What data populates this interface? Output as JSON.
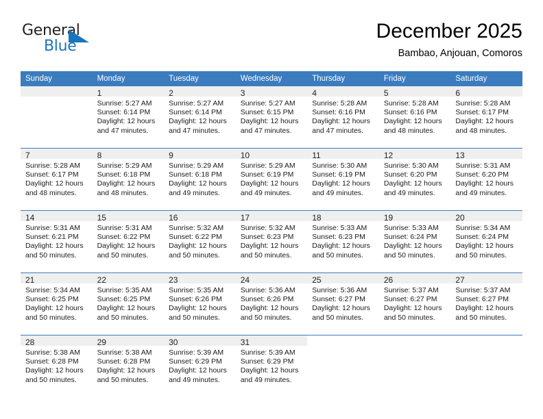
{
  "logo": {
    "text_top": "General",
    "text_bottom": "Blue",
    "brand_dark": "#231f20",
    "brand_blue": "#1b75bb"
  },
  "header": {
    "title": "December 2025",
    "subtitle": "Bambao, Anjouan, Comoros"
  },
  "calendar": {
    "header_bg": "#3b7cbe",
    "daynum_bg": "#efefef",
    "weekday_headers": [
      "Sunday",
      "Monday",
      "Tuesday",
      "Wednesday",
      "Thursday",
      "Friday",
      "Saturday"
    ],
    "weeks": [
      [
        {
          "day": "",
          "sunrise": "",
          "sunset": "",
          "daylight_line1": "",
          "daylight_line2": "",
          "state": "empty"
        },
        {
          "day": "1",
          "sunrise": "Sunrise: 5:27 AM",
          "sunset": "Sunset: 6:14 PM",
          "daylight_line1": "Daylight: 12 hours",
          "daylight_line2": "and 47 minutes.",
          "state": "filled"
        },
        {
          "day": "2",
          "sunrise": "Sunrise: 5:27 AM",
          "sunset": "Sunset: 6:14 PM",
          "daylight_line1": "Daylight: 12 hours",
          "daylight_line2": "and 47 minutes.",
          "state": "filled"
        },
        {
          "day": "3",
          "sunrise": "Sunrise: 5:27 AM",
          "sunset": "Sunset: 6:15 PM",
          "daylight_line1": "Daylight: 12 hours",
          "daylight_line2": "and 47 minutes.",
          "state": "filled"
        },
        {
          "day": "4",
          "sunrise": "Sunrise: 5:28 AM",
          "sunset": "Sunset: 6:16 PM",
          "daylight_line1": "Daylight: 12 hours",
          "daylight_line2": "and 47 minutes.",
          "state": "filled"
        },
        {
          "day": "5",
          "sunrise": "Sunrise: 5:28 AM",
          "sunset": "Sunset: 6:16 PM",
          "daylight_line1": "Daylight: 12 hours",
          "daylight_line2": "and 48 minutes.",
          "state": "filled"
        },
        {
          "day": "6",
          "sunrise": "Sunrise: 5:28 AM",
          "sunset": "Sunset: 6:17 PM",
          "daylight_line1": "Daylight: 12 hours",
          "daylight_line2": "and 48 minutes.",
          "state": "filled"
        }
      ],
      [
        {
          "day": "7",
          "sunrise": "Sunrise: 5:28 AM",
          "sunset": "Sunset: 6:17 PM",
          "daylight_line1": "Daylight: 12 hours",
          "daylight_line2": "and 48 minutes.",
          "state": "filled"
        },
        {
          "day": "8",
          "sunrise": "Sunrise: 5:29 AM",
          "sunset": "Sunset: 6:18 PM",
          "daylight_line1": "Daylight: 12 hours",
          "daylight_line2": "and 48 minutes.",
          "state": "filled"
        },
        {
          "day": "9",
          "sunrise": "Sunrise: 5:29 AM",
          "sunset": "Sunset: 6:18 PM",
          "daylight_line1": "Daylight: 12 hours",
          "daylight_line2": "and 49 minutes.",
          "state": "filled"
        },
        {
          "day": "10",
          "sunrise": "Sunrise: 5:29 AM",
          "sunset": "Sunset: 6:19 PM",
          "daylight_line1": "Daylight: 12 hours",
          "daylight_line2": "and 49 minutes.",
          "state": "filled"
        },
        {
          "day": "11",
          "sunrise": "Sunrise: 5:30 AM",
          "sunset": "Sunset: 6:19 PM",
          "daylight_line1": "Daylight: 12 hours",
          "daylight_line2": "and 49 minutes.",
          "state": "filled"
        },
        {
          "day": "12",
          "sunrise": "Sunrise: 5:30 AM",
          "sunset": "Sunset: 6:20 PM",
          "daylight_line1": "Daylight: 12 hours",
          "daylight_line2": "and 49 minutes.",
          "state": "filled"
        },
        {
          "day": "13",
          "sunrise": "Sunrise: 5:31 AM",
          "sunset": "Sunset: 6:20 PM",
          "daylight_line1": "Daylight: 12 hours",
          "daylight_line2": "and 49 minutes.",
          "state": "filled"
        }
      ],
      [
        {
          "day": "14",
          "sunrise": "Sunrise: 5:31 AM",
          "sunset": "Sunset: 6:21 PM",
          "daylight_line1": "Daylight: 12 hours",
          "daylight_line2": "and 50 minutes.",
          "state": "filled"
        },
        {
          "day": "15",
          "sunrise": "Sunrise: 5:31 AM",
          "sunset": "Sunset: 6:22 PM",
          "daylight_line1": "Daylight: 12 hours",
          "daylight_line2": "and 50 minutes.",
          "state": "filled"
        },
        {
          "day": "16",
          "sunrise": "Sunrise: 5:32 AM",
          "sunset": "Sunset: 6:22 PM",
          "daylight_line1": "Daylight: 12 hours",
          "daylight_line2": "and 50 minutes.",
          "state": "filled"
        },
        {
          "day": "17",
          "sunrise": "Sunrise: 5:32 AM",
          "sunset": "Sunset: 6:23 PM",
          "daylight_line1": "Daylight: 12 hours",
          "daylight_line2": "and 50 minutes.",
          "state": "filled"
        },
        {
          "day": "18",
          "sunrise": "Sunrise: 5:33 AM",
          "sunset": "Sunset: 6:23 PM",
          "daylight_line1": "Daylight: 12 hours",
          "daylight_line2": "and 50 minutes.",
          "state": "filled"
        },
        {
          "day": "19",
          "sunrise": "Sunrise: 5:33 AM",
          "sunset": "Sunset: 6:24 PM",
          "daylight_line1": "Daylight: 12 hours",
          "daylight_line2": "and 50 minutes.",
          "state": "filled"
        },
        {
          "day": "20",
          "sunrise": "Sunrise: 5:34 AM",
          "sunset": "Sunset: 6:24 PM",
          "daylight_line1": "Daylight: 12 hours",
          "daylight_line2": "and 50 minutes.",
          "state": "filled"
        }
      ],
      [
        {
          "day": "21",
          "sunrise": "Sunrise: 5:34 AM",
          "sunset": "Sunset: 6:25 PM",
          "daylight_line1": "Daylight: 12 hours",
          "daylight_line2": "and 50 minutes.",
          "state": "filled"
        },
        {
          "day": "22",
          "sunrise": "Sunrise: 5:35 AM",
          "sunset": "Sunset: 6:25 PM",
          "daylight_line1": "Daylight: 12 hours",
          "daylight_line2": "and 50 minutes.",
          "state": "filled"
        },
        {
          "day": "23",
          "sunrise": "Sunrise: 5:35 AM",
          "sunset": "Sunset: 6:26 PM",
          "daylight_line1": "Daylight: 12 hours",
          "daylight_line2": "and 50 minutes.",
          "state": "filled"
        },
        {
          "day": "24",
          "sunrise": "Sunrise: 5:36 AM",
          "sunset": "Sunset: 6:26 PM",
          "daylight_line1": "Daylight: 12 hours",
          "daylight_line2": "and 50 minutes.",
          "state": "filled"
        },
        {
          "day": "25",
          "sunrise": "Sunrise: 5:36 AM",
          "sunset": "Sunset: 6:27 PM",
          "daylight_line1": "Daylight: 12 hours",
          "daylight_line2": "and 50 minutes.",
          "state": "filled"
        },
        {
          "day": "26",
          "sunrise": "Sunrise: 5:37 AM",
          "sunset": "Sunset: 6:27 PM",
          "daylight_line1": "Daylight: 12 hours",
          "daylight_line2": "and 50 minutes.",
          "state": "filled"
        },
        {
          "day": "27",
          "sunrise": "Sunrise: 5:37 AM",
          "sunset": "Sunset: 6:27 PM",
          "daylight_line1": "Daylight: 12 hours",
          "daylight_line2": "and 50 minutes.",
          "state": "filled"
        }
      ],
      [
        {
          "day": "28",
          "sunrise": "Sunrise: 5:38 AM",
          "sunset": "Sunset: 6:28 PM",
          "daylight_line1": "Daylight: 12 hours",
          "daylight_line2": "and 50 minutes.",
          "state": "filled"
        },
        {
          "day": "29",
          "sunrise": "Sunrise: 5:38 AM",
          "sunset": "Sunset: 6:28 PM",
          "daylight_line1": "Daylight: 12 hours",
          "daylight_line2": "and 50 minutes.",
          "state": "filled"
        },
        {
          "day": "30",
          "sunrise": "Sunrise: 5:39 AM",
          "sunset": "Sunset: 6:29 PM",
          "daylight_line1": "Daylight: 12 hours",
          "daylight_line2": "and 49 minutes.",
          "state": "filled"
        },
        {
          "day": "31",
          "sunrise": "Sunrise: 5:39 AM",
          "sunset": "Sunset: 6:29 PM",
          "daylight_line1": "Daylight: 12 hours",
          "daylight_line2": "and 49 minutes.",
          "state": "filled"
        },
        {
          "day": "",
          "sunrise": "",
          "sunset": "",
          "daylight_line1": "",
          "daylight_line2": "",
          "state": "blank"
        },
        {
          "day": "",
          "sunrise": "",
          "sunset": "",
          "daylight_line1": "",
          "daylight_line2": "",
          "state": "blank"
        },
        {
          "day": "",
          "sunrise": "",
          "sunset": "",
          "daylight_line1": "",
          "daylight_line2": "",
          "state": "blank"
        }
      ]
    ]
  }
}
